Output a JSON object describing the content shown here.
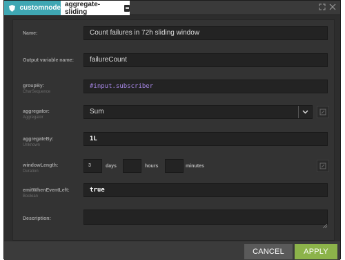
{
  "tabs": {
    "node_type": "customnode",
    "node_name": "aggregate-sliding"
  },
  "fields": {
    "name": {
      "label": "Name:",
      "value": "Count failures in 72h sliding window"
    },
    "output_var": {
      "label": "Output variable name:",
      "value": "failureCount"
    },
    "group_by": {
      "label": "groupBy:",
      "type": "CharSequence",
      "value": "#input.subscriber"
    },
    "aggregator": {
      "label": "aggregator:",
      "type": "Aggregator",
      "value": "Sum"
    },
    "aggregate_by": {
      "label": "aggregateBy:",
      "type": "Unknown",
      "value": "1L"
    },
    "window_length": {
      "label": "windowLength:",
      "type": "Duration",
      "days_value": "3",
      "days_unit": "days",
      "hours_value": "",
      "hours_unit": "hours",
      "minutes_value": "",
      "minutes_unit": "minutes"
    },
    "emit_when_event_left": {
      "label": "emitWhenEventLeft:",
      "type": "Boolean",
      "value": "true"
    },
    "description": {
      "label": "Description:",
      "value": ""
    }
  },
  "footer": {
    "cancel_label": "CANCEL",
    "apply_label": "APPLY"
  },
  "colors": {
    "accent_tab": "#3fa7b3",
    "apply_button": "#8cb34a",
    "expression_purple": "#a686e6"
  }
}
